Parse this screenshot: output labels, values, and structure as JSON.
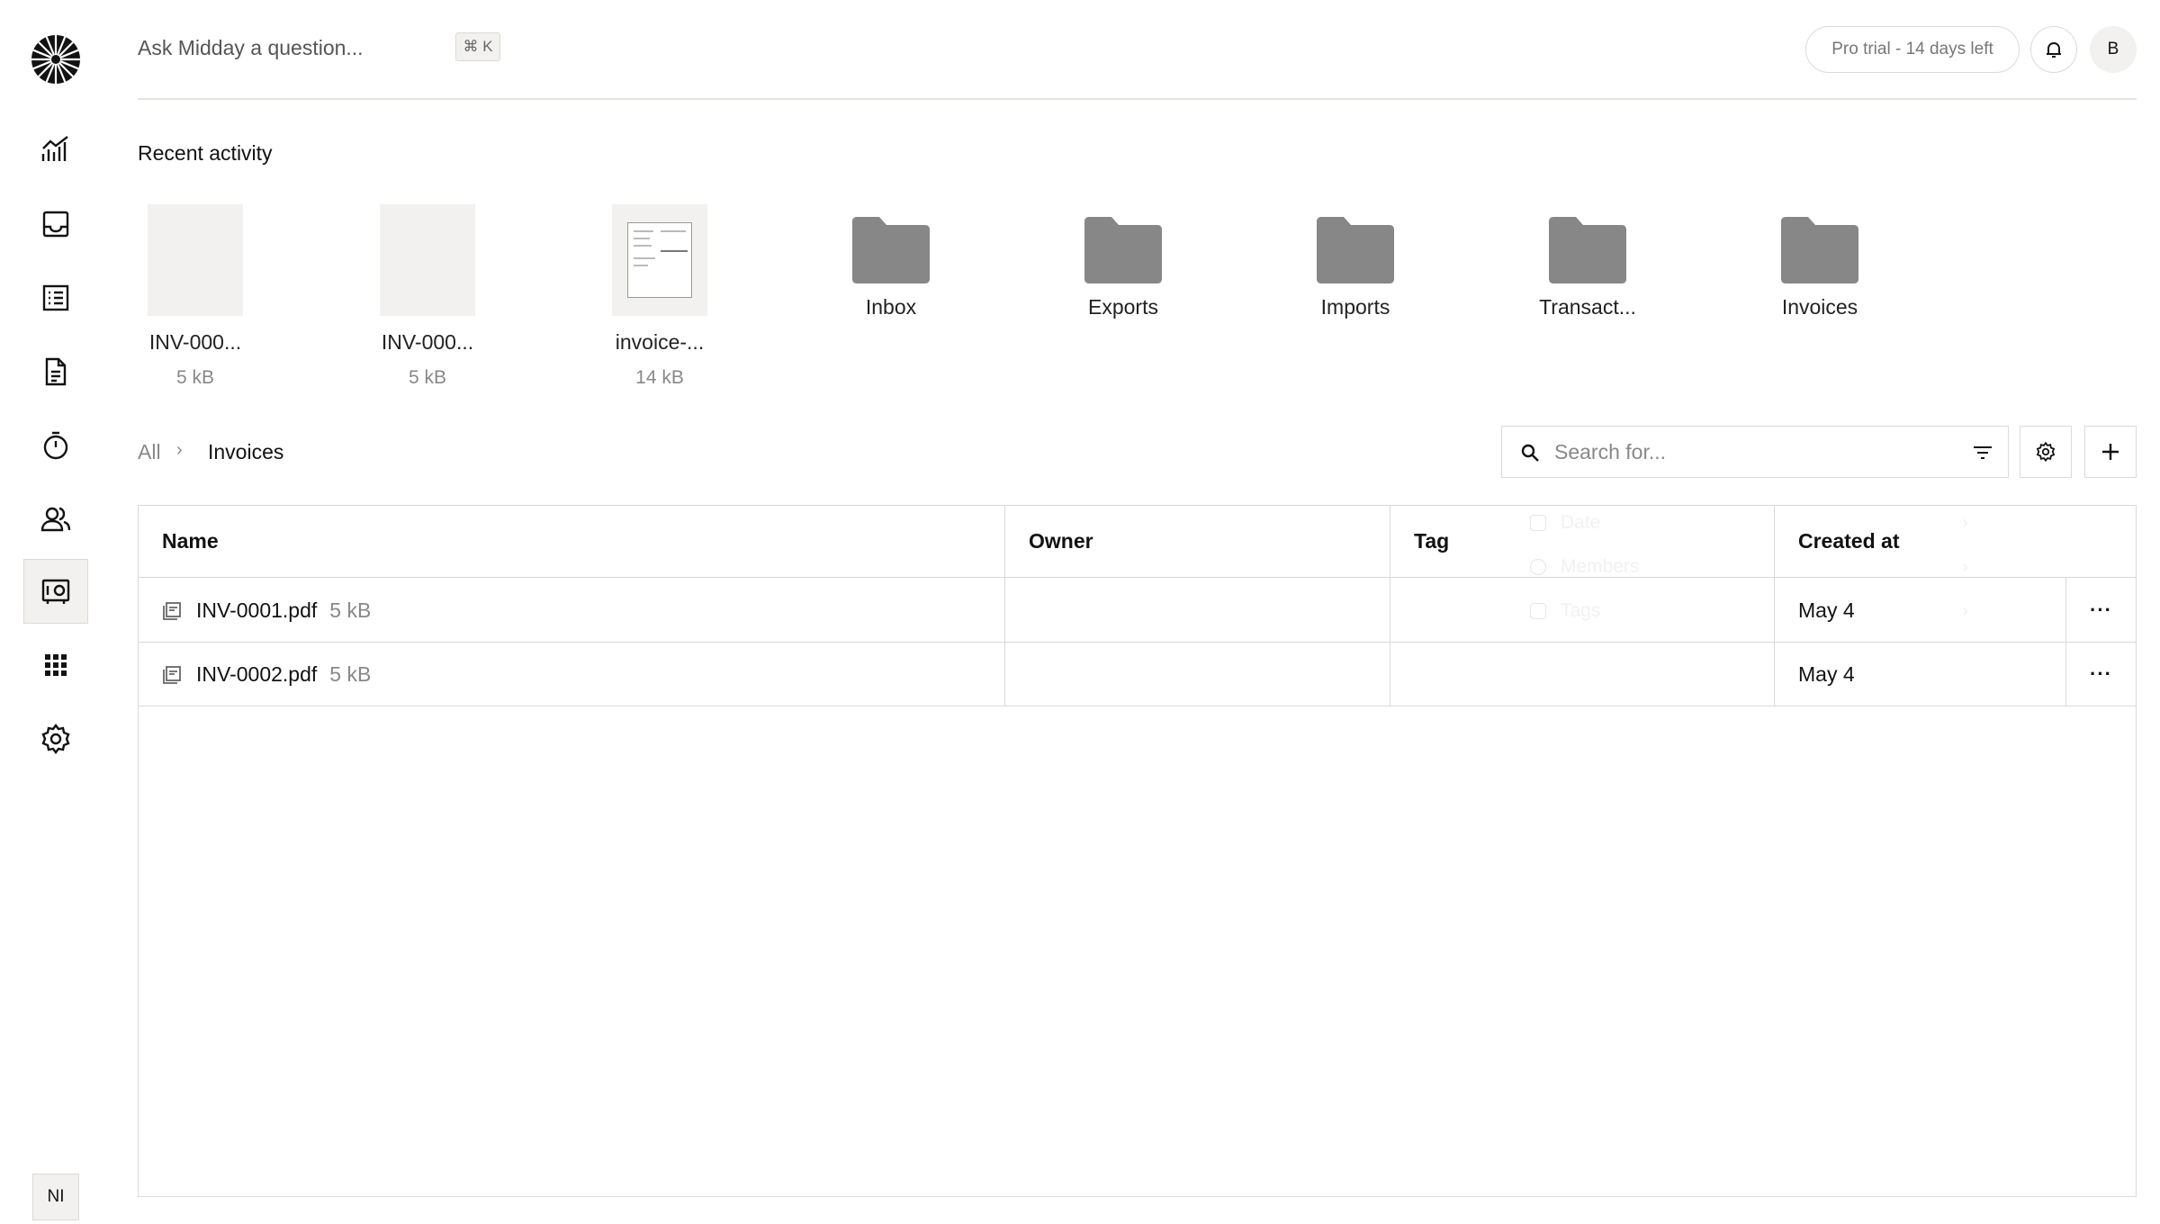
{
  "header": {
    "ask_placeholder": "Ask Midday a question...",
    "shortcut": "⌘ K",
    "trial_badge": "Pro trial - 14 days left",
    "avatar_initial": "B"
  },
  "sidebar": {
    "items": [
      {
        "name": "overview",
        "icon": "chart-icon"
      },
      {
        "name": "inbox",
        "icon": "inbox-icon"
      },
      {
        "name": "transactions",
        "icon": "list-icon"
      },
      {
        "name": "invoices",
        "icon": "document-icon"
      },
      {
        "name": "tracker",
        "icon": "timer-icon"
      },
      {
        "name": "customers",
        "icon": "users-icon"
      },
      {
        "name": "vault",
        "icon": "vault-icon",
        "active": true
      },
      {
        "name": "apps",
        "icon": "grid-icon"
      },
      {
        "name": "settings",
        "icon": "gear-icon"
      }
    ],
    "org_badge": "NI"
  },
  "recent": {
    "title": "Recent activity",
    "files": [
      {
        "name": "INV-000...",
        "size": "5 kB"
      },
      {
        "name": "INV-000...",
        "size": "5 kB"
      },
      {
        "name": "invoice-...",
        "size": "14 kB"
      }
    ],
    "folders": [
      "Inbox",
      "Exports",
      "Imports",
      "Transact...",
      "Invoices"
    ]
  },
  "breadcrumb": {
    "root": "All",
    "separator": "›",
    "current": "Invoices"
  },
  "search": {
    "placeholder": "Search for..."
  },
  "filter_menu": {
    "items": [
      "Date",
      "Members",
      "Tags"
    ]
  },
  "table": {
    "columns": [
      "Name",
      "Owner",
      "Tag",
      "Created at"
    ],
    "rows": [
      {
        "name": "INV-0001.pdf",
        "size": "5 kB",
        "owner": "",
        "tag": "",
        "created": "May 4",
        "actions": "···"
      },
      {
        "name": "INV-0002.pdf",
        "size": "5 kB",
        "owner": "",
        "tag": "",
        "created": "May 4",
        "actions": "···"
      }
    ]
  },
  "colors": {
    "border": "#dcdad6",
    "muted_bg": "#f2f1ef",
    "folder": "#878787",
    "text": "#121212",
    "muted_text": "#888888"
  }
}
